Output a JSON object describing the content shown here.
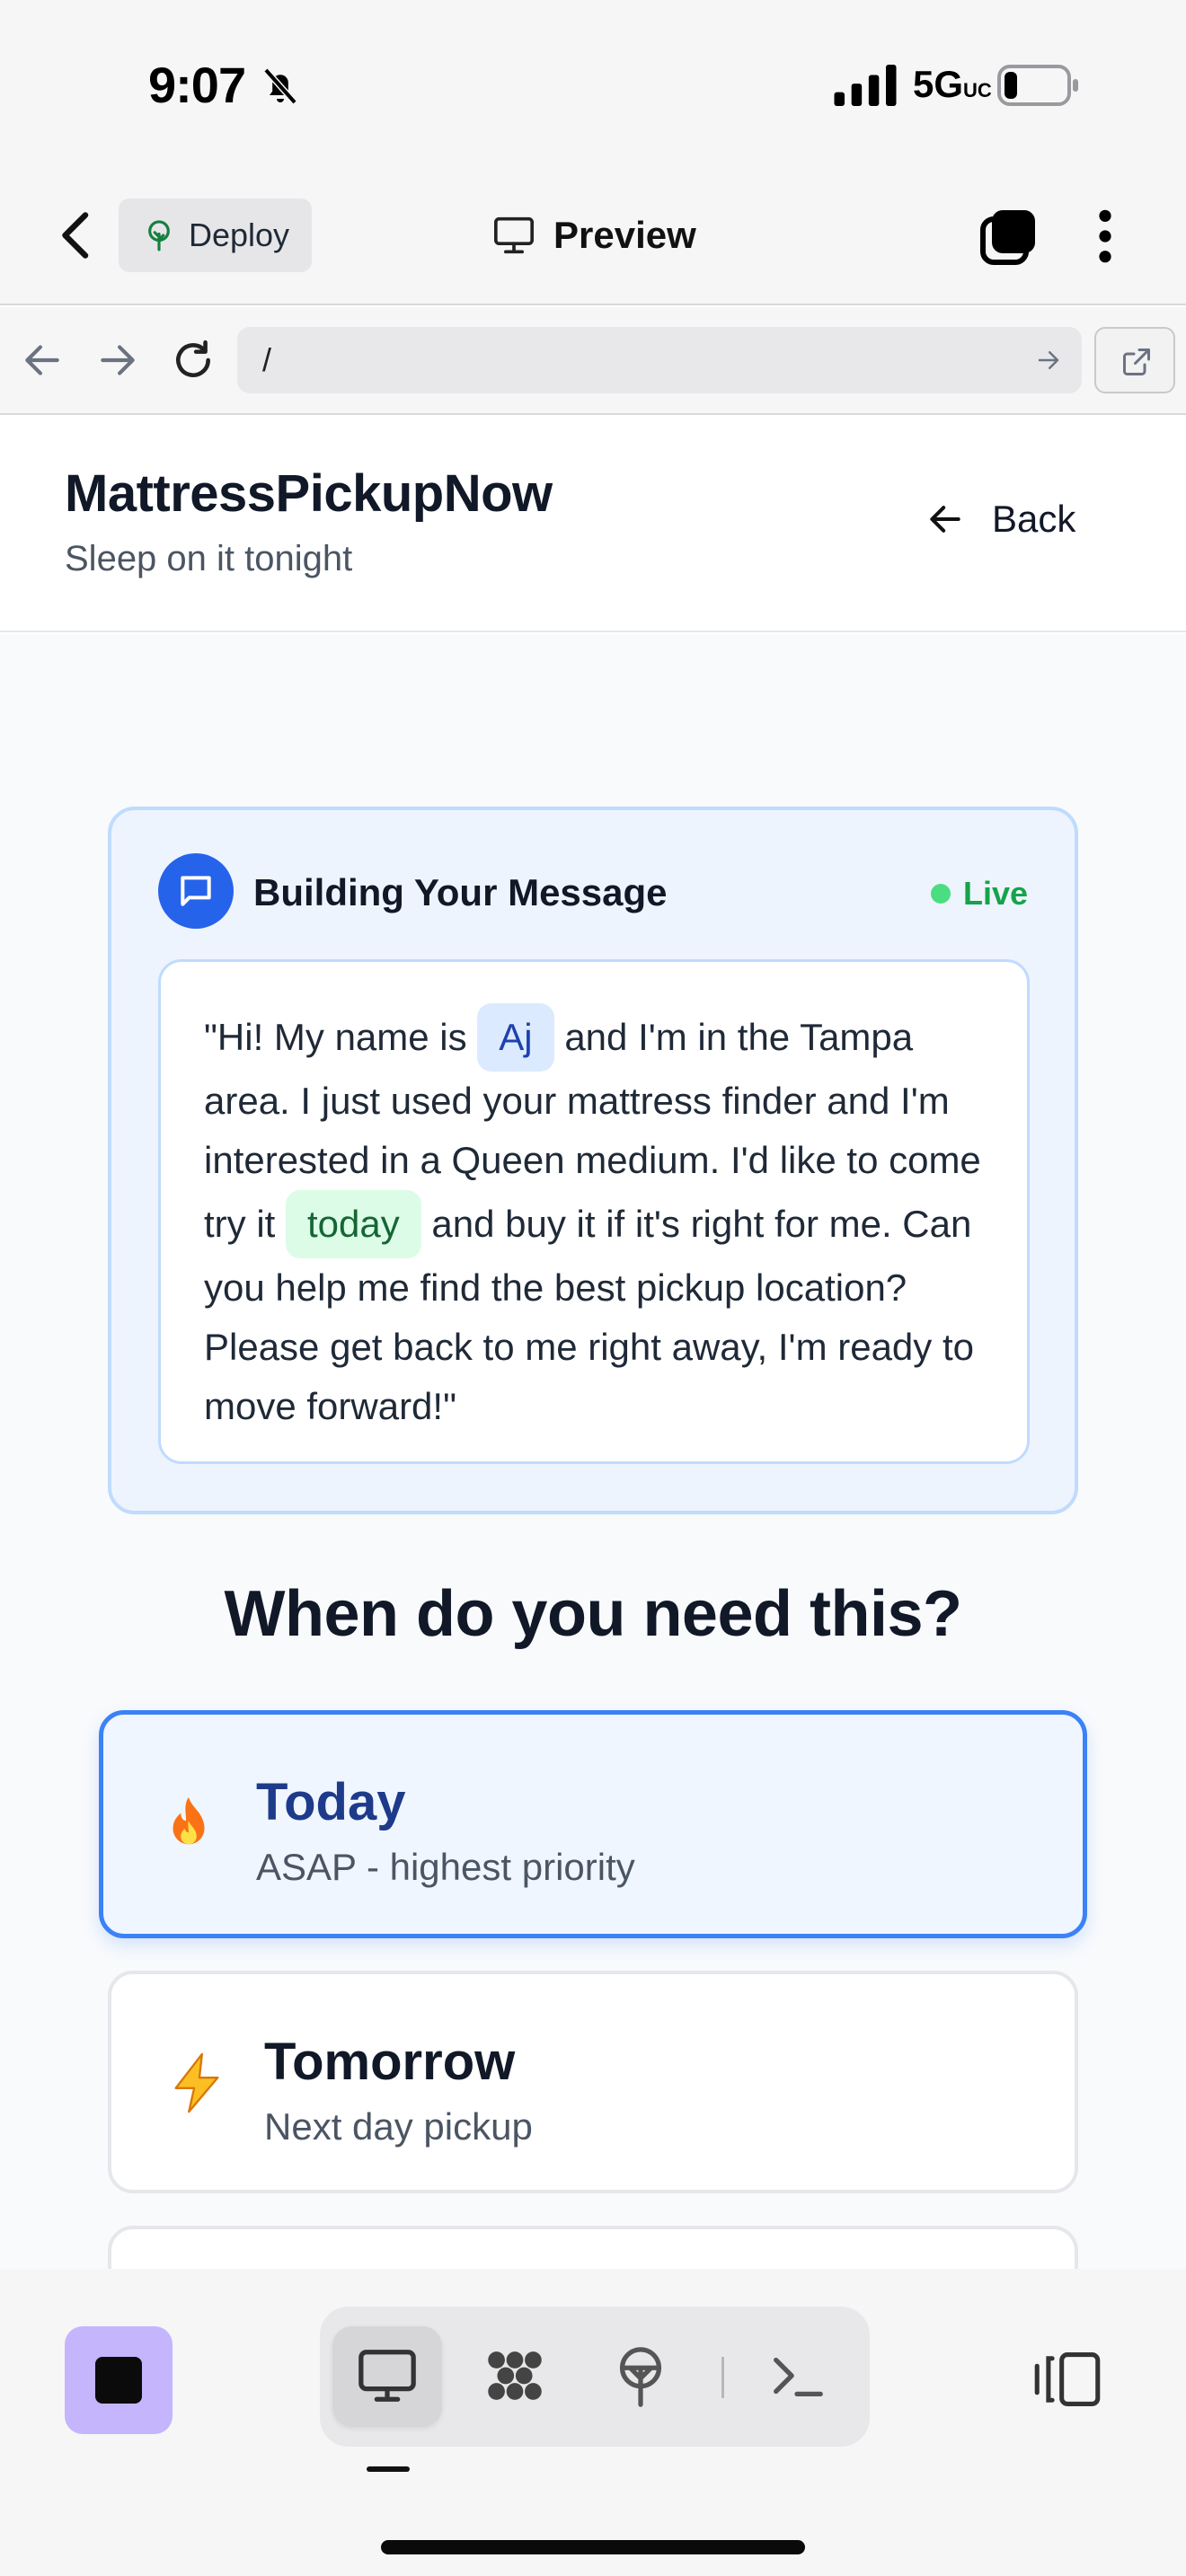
{
  "status_bar": {
    "time": "9:07",
    "network": "5G",
    "network_suffix": "UC",
    "icons": [
      "bell-slash-icon",
      "cellular-signal-icon",
      "battery-icon"
    ]
  },
  "toolbar": {
    "deploy_label": "Deploy",
    "preview_label": "Preview",
    "icons": [
      "chevron-left-icon",
      "deploy-tree-icon",
      "monitor-icon",
      "tabs-icon",
      "more-vertical-icon"
    ]
  },
  "browser": {
    "url": "/",
    "icons": [
      "arrow-left-icon",
      "arrow-right-icon",
      "reload-icon",
      "go-arrow-icon",
      "external-link-icon"
    ]
  },
  "site": {
    "title": "MattressPickupNow",
    "tagline": "Sleep on it tonight",
    "back_label": "Back"
  },
  "message_card": {
    "title": "Building Your Message",
    "status": "Live",
    "status_color": "#16a34a",
    "accent_color": "#2563eb",
    "parts": {
      "p1": "\"Hi! My name is ",
      "name": "Aj",
      "p2": " and I'm in the Tampa area. I just used your mattress finder and I'm interested in a Queen medium. I'd like to come try it ",
      "timing": "today",
      "p3": " and buy it if it's right for me. Can you help me find the best pickup location? Please get back to me right away, I'm ready to move forward!\""
    }
  },
  "question": "When do you need this?",
  "options": [
    {
      "title": "Today",
      "subtitle": "ASAP - highest priority",
      "icon": "fire-emoji",
      "selected": true
    },
    {
      "title": "Tomorrow",
      "subtitle": "Next day pickup",
      "icon": "lightning-emoji",
      "selected": false
    }
  ],
  "bottom_bar": {
    "active_tab": "preview",
    "tabs": [
      "monitor-icon",
      "workflow-icon",
      "deploy-icon",
      "terminal-icon"
    ],
    "accent_color": "#c4b5fd"
  }
}
